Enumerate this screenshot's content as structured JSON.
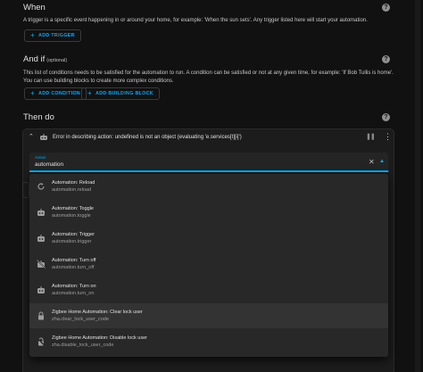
{
  "when": {
    "title": "When",
    "description": "A trigger is a specific event happening in or around your home, for example: 'When the sun sets'. Any trigger listed here will start your automation.",
    "add_trigger_label": "ADD TRIGGER",
    "help_icon": "help-icon"
  },
  "and_if": {
    "title": "And if",
    "optional_label": "(optional)",
    "description": "This list of conditions needs to be satisfied for the automation to run. A condition can be satisfied or not at any given time, for example: 'If Bob Tullis is home'. You can use building blocks to create more complex conditions.",
    "add_condition_label": "ADD CONDITION",
    "add_building_block_label": "ADD BUILDING BLOCK"
  },
  "then_do": {
    "title": "Then do",
    "action_card": {
      "error_text": "Error in describing action: undefined is not an object (evaluating 'e.services[t][i]')",
      "field_label": "Action",
      "field_value": "automation"
    },
    "options": [
      {
        "title": "Automation: Reload",
        "service": "automation.reload",
        "icon": "reload-icon"
      },
      {
        "title": "Automation: Toggle",
        "service": "automation.toggle",
        "icon": "robot-icon"
      },
      {
        "title": "Automation: Trigger",
        "service": "automation.trigger",
        "icon": "robot-icon"
      },
      {
        "title": "Automation: Turn off",
        "service": "automation.turn_off",
        "icon": "robot-off-icon"
      },
      {
        "title": "Automation: Turn on",
        "service": "automation.turn_on",
        "icon": "robot-icon"
      },
      {
        "title": "Zigbee Home Automation: Clear lock user",
        "service": "zha.clear_lock_user_code",
        "icon": "lock-icon"
      },
      {
        "title": "Zigbee Home Automation: Disable lock user",
        "service": "zha.disable_lock_user_code",
        "icon": "lock-icon"
      }
    ]
  },
  "colors": {
    "accent": "#03a9f4",
    "background": "#111111",
    "card": "#1c1c1c",
    "menu": "#282828"
  }
}
